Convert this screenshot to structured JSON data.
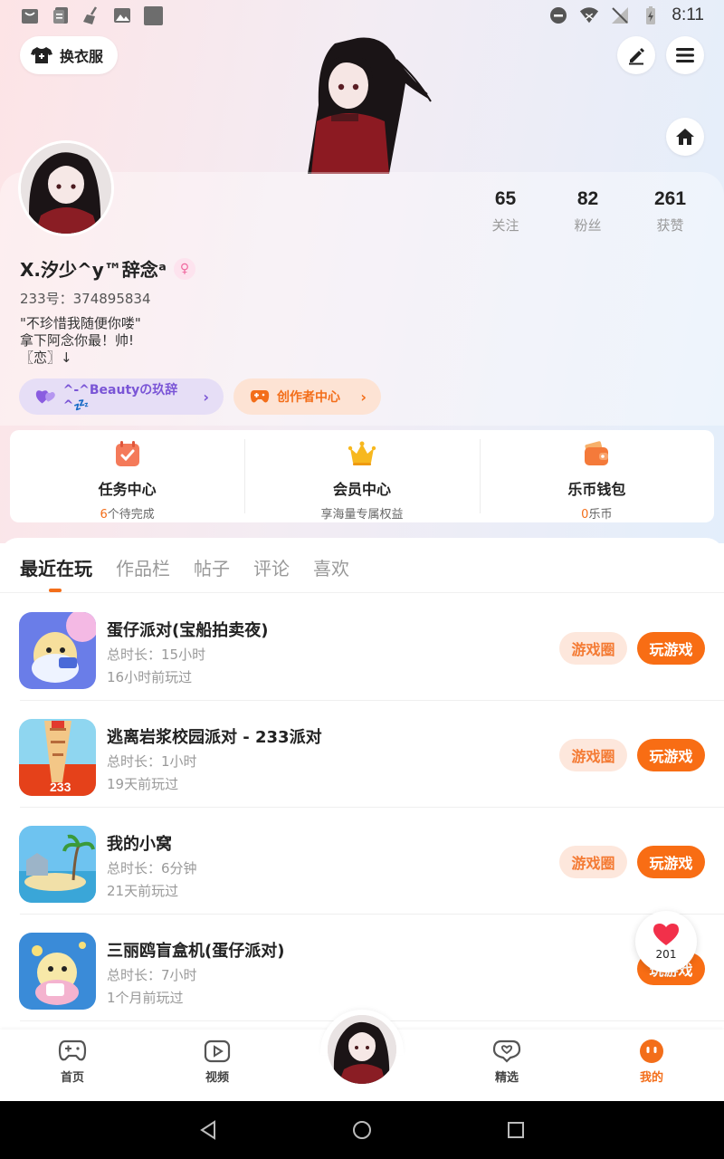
{
  "status_bar": {
    "time": "8:11",
    "left_icons": [
      "shopping-bag-icon",
      "document-icon",
      "broom-icon",
      "image-icon",
      "square-icon"
    ],
    "right_icons": [
      "do-not-disturb-icon",
      "wifi-icon",
      "no-signal-icon",
      "battery-icon"
    ]
  },
  "header": {
    "outfit_label": "换衣服",
    "edit_icon": "edit-icon",
    "menu_icon": "menu-icon",
    "home_icon": "home-icon"
  },
  "profile": {
    "username": "X.汐少^y™辞念ᵃ",
    "gender_icon": "female-icon",
    "user_id": "233号：374895834",
    "bio_lines": [
      "\"不珍惜我随便你喽\"",
      "拿下阿念你最！帅!",
      "〖恋〗↓"
    ],
    "stats": [
      {
        "value": "65",
        "label": "关注"
      },
      {
        "value": "82",
        "label": "粉丝"
      },
      {
        "value": "261",
        "label": "获赞"
      }
    ],
    "fan_club": "^-^Beautyの玖辞^💤",
    "creator_center": "创作者中心"
  },
  "services": [
    {
      "title": "任务中心",
      "count": "6",
      "subtitle": "个待完成",
      "icon": "task-calendar-icon"
    },
    {
      "title": "会员中心",
      "count": "",
      "subtitle": "享海量专属权益",
      "icon": "crown-icon"
    },
    {
      "title": "乐币钱包",
      "count": "0",
      "subtitle": "乐币",
      "icon": "wallet-icon"
    }
  ],
  "tabs": [
    "最近在玩",
    "作品栏",
    "帖子",
    "评论",
    "喜欢"
  ],
  "games": [
    {
      "title": "蛋仔派对(宝船拍卖夜)",
      "duration": "总时长：15小时",
      "last_played": "16小时前玩过"
    },
    {
      "title": "逃离岩浆校园派对 - 233派对",
      "duration": "总时长：1小时",
      "last_played": "19天前玩过"
    },
    {
      "title": "我的小窝",
      "duration": "总时长：6分钟",
      "last_played": "21天前玩过"
    },
    {
      "title": "三丽鸥盲盒机(蛋仔派对)",
      "duration": "总时长：7小时",
      "last_played": "1个月前玩过"
    }
  ],
  "game_buttons": {
    "circle": "游戏圈",
    "play": "玩游戏"
  },
  "like_float": {
    "count": "201"
  },
  "bottom_nav": [
    {
      "label": "首页",
      "icon": "gamepad-icon"
    },
    {
      "label": "视频",
      "icon": "video-play-icon"
    },
    {
      "label": "",
      "icon": "avatar-center"
    },
    {
      "label": "精选",
      "icon": "heart-chat-icon"
    },
    {
      "label": "我的",
      "icon": "profile-face-icon"
    }
  ],
  "colors": {
    "accent": "#f36e1a",
    "play_button": "#f86d14",
    "fan_purple": "#7a55d6"
  }
}
